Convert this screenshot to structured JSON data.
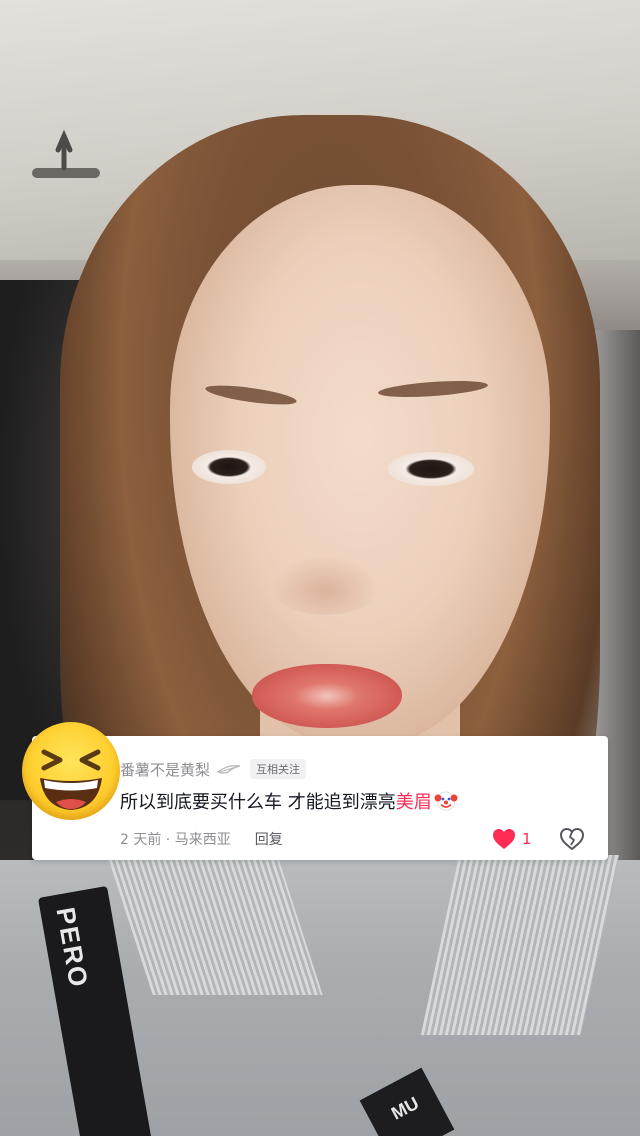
{
  "video": {
    "lanyard_text": "PERO",
    "badge_text": "MU"
  },
  "comment": {
    "avatar_icon": "grinning-squinting-face-emoji",
    "username": "番薯不是黄梨",
    "username_badge_icon": "feather-icon",
    "relation_tag": "互相关注",
    "text_main": "所以到底要买什么车 才能追到漂亮",
    "text_highlight": "美眉",
    "text_emoji_icon": "clown-face-emoji",
    "time_location": "2 天前 · 马来西亚",
    "reply_label": "回复",
    "like_count": "1",
    "liked": true,
    "colors": {
      "highlight": "#fe2c55",
      "like": "#fe2c55",
      "secondary_text": "#8e8e93"
    }
  }
}
